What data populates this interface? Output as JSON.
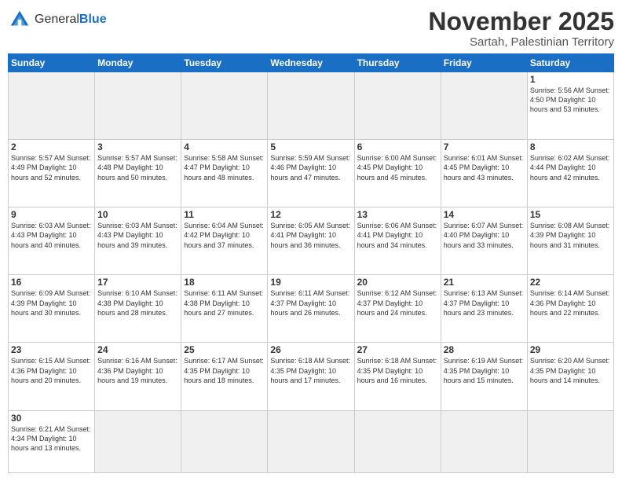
{
  "logo": {
    "text_general": "General",
    "text_blue": "Blue"
  },
  "header": {
    "month_title": "November 2025",
    "subtitle": "Sartah, Palestinian Territory"
  },
  "weekdays": [
    "Sunday",
    "Monday",
    "Tuesday",
    "Wednesday",
    "Thursday",
    "Friday",
    "Saturday"
  ],
  "days": [
    {
      "date": "",
      "info": ""
    },
    {
      "date": "",
      "info": ""
    },
    {
      "date": "",
      "info": ""
    },
    {
      "date": "",
      "info": ""
    },
    {
      "date": "",
      "info": ""
    },
    {
      "date": "",
      "info": ""
    },
    {
      "date": "1",
      "info": "Sunrise: 5:56 AM\nSunset: 4:50 PM\nDaylight: 10 hours\nand 53 minutes."
    },
    {
      "date": "2",
      "info": "Sunrise: 5:57 AM\nSunset: 4:49 PM\nDaylight: 10 hours\nand 52 minutes."
    },
    {
      "date": "3",
      "info": "Sunrise: 5:57 AM\nSunset: 4:48 PM\nDaylight: 10 hours\nand 50 minutes."
    },
    {
      "date": "4",
      "info": "Sunrise: 5:58 AM\nSunset: 4:47 PM\nDaylight: 10 hours\nand 48 minutes."
    },
    {
      "date": "5",
      "info": "Sunrise: 5:59 AM\nSunset: 4:46 PM\nDaylight: 10 hours\nand 47 minutes."
    },
    {
      "date": "6",
      "info": "Sunrise: 6:00 AM\nSunset: 4:45 PM\nDaylight: 10 hours\nand 45 minutes."
    },
    {
      "date": "7",
      "info": "Sunrise: 6:01 AM\nSunset: 4:45 PM\nDaylight: 10 hours\nand 43 minutes."
    },
    {
      "date": "8",
      "info": "Sunrise: 6:02 AM\nSunset: 4:44 PM\nDaylight: 10 hours\nand 42 minutes."
    },
    {
      "date": "9",
      "info": "Sunrise: 6:03 AM\nSunset: 4:43 PM\nDaylight: 10 hours\nand 40 minutes."
    },
    {
      "date": "10",
      "info": "Sunrise: 6:03 AM\nSunset: 4:43 PM\nDaylight: 10 hours\nand 39 minutes."
    },
    {
      "date": "11",
      "info": "Sunrise: 6:04 AM\nSunset: 4:42 PM\nDaylight: 10 hours\nand 37 minutes."
    },
    {
      "date": "12",
      "info": "Sunrise: 6:05 AM\nSunset: 4:41 PM\nDaylight: 10 hours\nand 36 minutes."
    },
    {
      "date": "13",
      "info": "Sunrise: 6:06 AM\nSunset: 4:41 PM\nDaylight: 10 hours\nand 34 minutes."
    },
    {
      "date": "14",
      "info": "Sunrise: 6:07 AM\nSunset: 4:40 PM\nDaylight: 10 hours\nand 33 minutes."
    },
    {
      "date": "15",
      "info": "Sunrise: 6:08 AM\nSunset: 4:39 PM\nDaylight: 10 hours\nand 31 minutes."
    },
    {
      "date": "16",
      "info": "Sunrise: 6:09 AM\nSunset: 4:39 PM\nDaylight: 10 hours\nand 30 minutes."
    },
    {
      "date": "17",
      "info": "Sunrise: 6:10 AM\nSunset: 4:38 PM\nDaylight: 10 hours\nand 28 minutes."
    },
    {
      "date": "18",
      "info": "Sunrise: 6:11 AM\nSunset: 4:38 PM\nDaylight: 10 hours\nand 27 minutes."
    },
    {
      "date": "19",
      "info": "Sunrise: 6:11 AM\nSunset: 4:37 PM\nDaylight: 10 hours\nand 26 minutes."
    },
    {
      "date": "20",
      "info": "Sunrise: 6:12 AM\nSunset: 4:37 PM\nDaylight: 10 hours\nand 24 minutes."
    },
    {
      "date": "21",
      "info": "Sunrise: 6:13 AM\nSunset: 4:37 PM\nDaylight: 10 hours\nand 23 minutes."
    },
    {
      "date": "22",
      "info": "Sunrise: 6:14 AM\nSunset: 4:36 PM\nDaylight: 10 hours\nand 22 minutes."
    },
    {
      "date": "23",
      "info": "Sunrise: 6:15 AM\nSunset: 4:36 PM\nDaylight: 10 hours\nand 20 minutes."
    },
    {
      "date": "24",
      "info": "Sunrise: 6:16 AM\nSunset: 4:36 PM\nDaylight: 10 hours\nand 19 minutes."
    },
    {
      "date": "25",
      "info": "Sunrise: 6:17 AM\nSunset: 4:35 PM\nDaylight: 10 hours\nand 18 minutes."
    },
    {
      "date": "26",
      "info": "Sunrise: 6:18 AM\nSunset: 4:35 PM\nDaylight: 10 hours\nand 17 minutes."
    },
    {
      "date": "27",
      "info": "Sunrise: 6:18 AM\nSunset: 4:35 PM\nDaylight: 10 hours\nand 16 minutes."
    },
    {
      "date": "28",
      "info": "Sunrise: 6:19 AM\nSunset: 4:35 PM\nDaylight: 10 hours\nand 15 minutes."
    },
    {
      "date": "29",
      "info": "Sunrise: 6:20 AM\nSunset: 4:35 PM\nDaylight: 10 hours\nand 14 minutes."
    },
    {
      "date": "30",
      "info": "Sunrise: 6:21 AM\nSunset: 4:34 PM\nDaylight: 10 hours\nand 13 minutes."
    },
    {
      "date": "",
      "info": ""
    },
    {
      "date": "",
      "info": ""
    },
    {
      "date": "",
      "info": ""
    },
    {
      "date": "",
      "info": ""
    },
    {
      "date": "",
      "info": ""
    },
    {
      "date": "",
      "info": ""
    }
  ]
}
